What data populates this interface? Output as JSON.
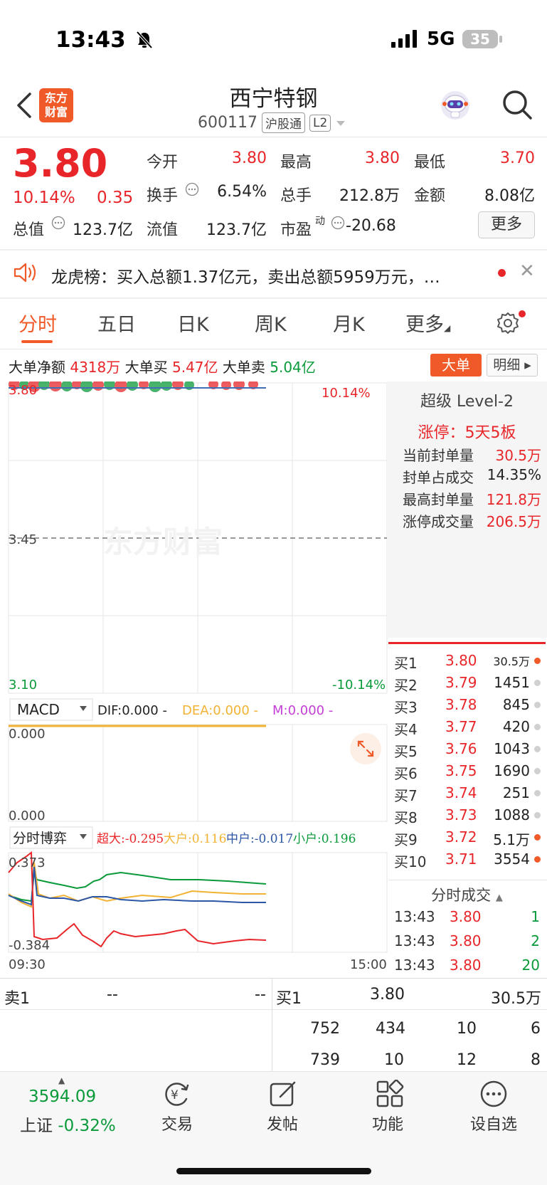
{
  "status_bar": {
    "time": "13:43",
    "network": "5G",
    "battery": "35"
  },
  "header": {
    "logo_line1": "东方",
    "logo_line2": "财富",
    "stock_name": "西宁特钢",
    "code": "600117",
    "tag_hgt": "沪股通",
    "tag_level": "L2"
  },
  "quote": {
    "price": "3.80",
    "change_pct": "10.14%",
    "change": "0.35",
    "open_label": "今开",
    "open": "3.80",
    "high_label": "最高",
    "high": "3.80",
    "low_label": "最低",
    "low": "3.70",
    "turnover_label": "换手",
    "turnover": "6.54%",
    "volume_label": "总手",
    "volume": "212.8万",
    "amount_label": "金额",
    "amount": "8.08亿",
    "mktcap_label": "总值",
    "mktcap": "123.7亿",
    "float_label": "流值",
    "float": "123.7亿",
    "pe_label": "市盈",
    "pe_sup": "动",
    "pe": "-20.68",
    "more": "更多"
  },
  "news": {
    "text": "龙虎榜：买入总额1.37亿元，卖出总额5959万元，…"
  },
  "tabs": [
    "分时",
    "五日",
    "日K",
    "周K",
    "月K",
    "更多"
  ],
  "big_order": {
    "net_label": "大单净额",
    "net": "4318万",
    "buy_label": "大单买",
    "buy": "5.47亿",
    "sell_label": "大单卖",
    "sell": "5.04亿",
    "btn_big": "大单",
    "btn_detail": "明细"
  },
  "chart": {
    "price_top": "3.80",
    "pct_top": "10.14%",
    "price_mid": "3.45",
    "price_bottom": "3.10",
    "pct_bottom": "-10.14%",
    "watermark": "东方财富",
    "macd_label": "MACD",
    "dif": "DIF:0.000 -",
    "dea": "DEA:0.000 -",
    "m": "M:0.000 -",
    "macd_top": "0.000",
    "macd_bottom": "0.000",
    "game_label": "分时博弈",
    "super": "超大:-0.295",
    "large": "大户:0.116",
    "mid": "中户:-0.017",
    "small": "小户:0.196",
    "game_top": "0.373",
    "game_bottom": "-0.384",
    "time_start": "09:30",
    "time_end": "15:00"
  },
  "level2": {
    "title": "超级 Level-2",
    "limit_status": "涨停：5天5板",
    "rows": [
      {
        "label": "当前封单量",
        "value": "30.5万"
      },
      {
        "label": "封单占成交",
        "value": "14.35%"
      },
      {
        "label": "最高封单量",
        "value": "121.8万"
      },
      {
        "label": "涨停成交量",
        "value": "206.5万"
      }
    ]
  },
  "order_book": [
    {
      "label": "买1",
      "price": "3.80",
      "vol": "30.5万",
      "dot": "#f05a28"
    },
    {
      "label": "买2",
      "price": "3.79",
      "vol": "1451",
      "dot": "#d0d0d0"
    },
    {
      "label": "买3",
      "price": "3.78",
      "vol": "845",
      "dot": "#d0d0d0"
    },
    {
      "label": "买4",
      "price": "3.77",
      "vol": "420",
      "dot": "#d0d0d0"
    },
    {
      "label": "买5",
      "price": "3.76",
      "vol": "1043",
      "dot": "#d0d0d0"
    },
    {
      "label": "买6",
      "price": "3.75",
      "vol": "1690",
      "dot": "#d0d0d0"
    },
    {
      "label": "买7",
      "price": "3.74",
      "vol": "251",
      "dot": "#d0d0d0"
    },
    {
      "label": "买8",
      "price": "3.73",
      "vol": "1088",
      "dot": "#d0d0d0"
    },
    {
      "label": "买9",
      "price": "3.72",
      "vol": "5.1万",
      "dot": "#f05a28"
    },
    {
      "label": "买10",
      "price": "3.71",
      "vol": "3554",
      "dot": "#f05a28"
    }
  ],
  "trades": {
    "title": "分时成交",
    "rows": [
      {
        "time": "13:43",
        "price": "3.80",
        "vol": "1"
      },
      {
        "time": "13:43",
        "price": "3.80",
        "vol": "2"
      },
      {
        "time": "13:43",
        "price": "3.80",
        "vol": "20"
      }
    ]
  },
  "bottom_book": {
    "sell_label": "卖1",
    "sell_price": "--",
    "sell_vol": "--",
    "buy_label": "买1",
    "buy_price": "3.80",
    "buy_vol": "30.5万",
    "queue_row1": [
      "752",
      "434",
      "10",
      "6"
    ],
    "queue_row2": [
      "739",
      "10",
      "12",
      "8"
    ]
  },
  "bottom_nav": {
    "index_value": "3594.09",
    "index_name": "上证",
    "index_change": "-0.32%",
    "trade": "交易",
    "post": "发帖",
    "function": "功能",
    "watchlist": "设自选"
  },
  "colors": {
    "up": "#e8262a",
    "down": "#0a9a3a",
    "accent": "#f05a28"
  }
}
